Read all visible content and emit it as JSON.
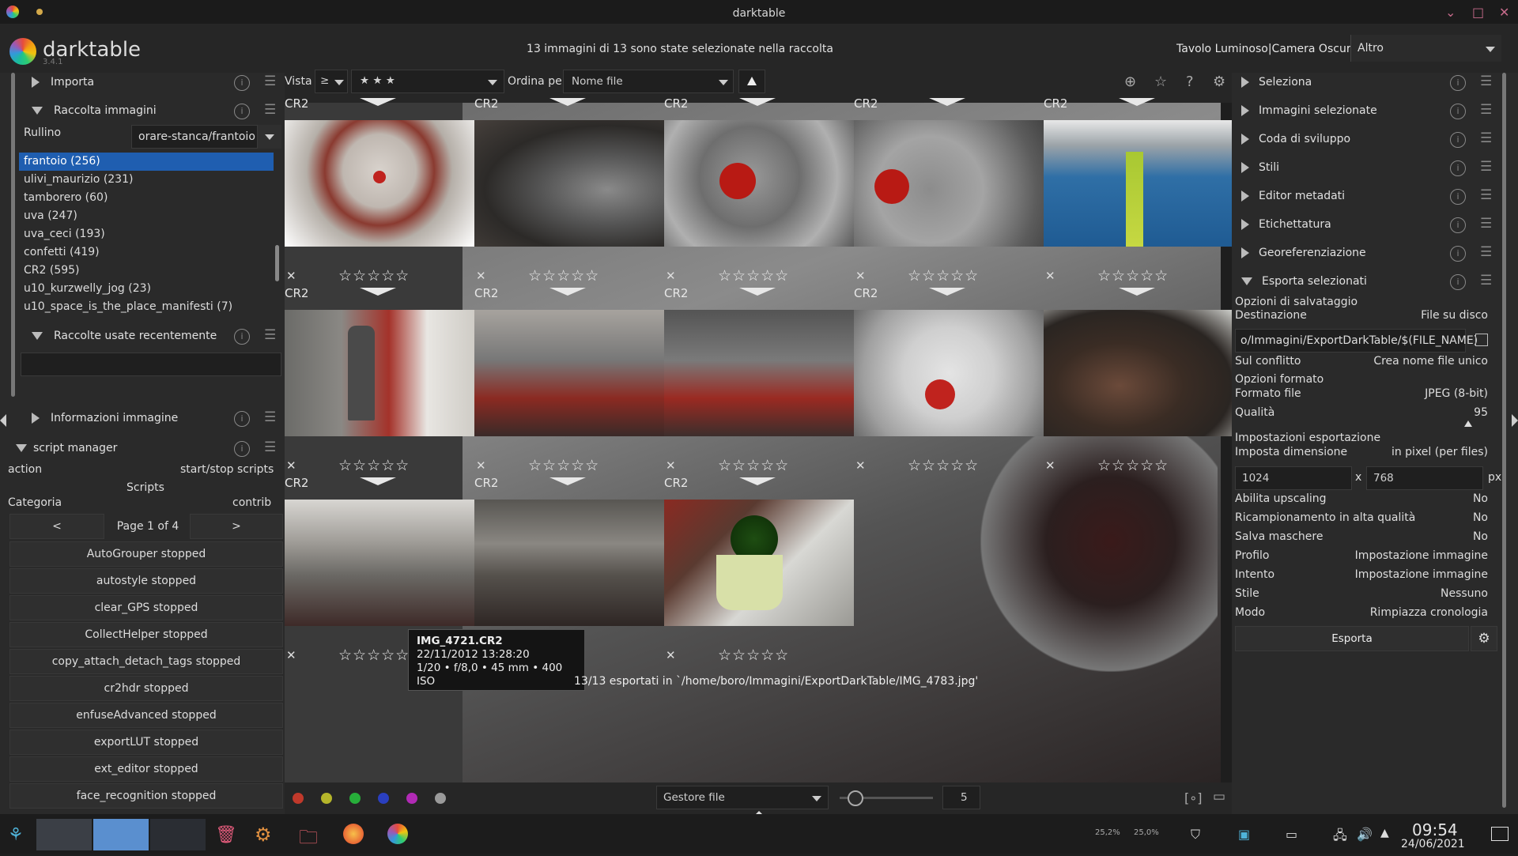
{
  "window": {
    "title": "darktable"
  },
  "header": {
    "app_name": "darktable",
    "version": "3.4.1",
    "selection_message": "13 immagini di 13 sono state selezionate nella raccolta",
    "views": "Tavolo Luminoso|Camera Oscura|",
    "views_dropdown": "Altro"
  },
  "left_panel": {
    "modules": {
      "import": "Importa",
      "collections": "Raccolta immagini",
      "recent": "Raccolte usate recentemente",
      "image_info": "Informazioni immagine",
      "script_manager": "script manager"
    },
    "collection": {
      "property": "Rullino",
      "path": "orare-stanca/frantoio",
      "items": [
        "frantoio (256)",
        "ulivi_maurizio (231)",
        "tamborero (60)",
        "uva (247)",
        "uva_ceci (193)",
        "confetti (419)",
        "CR2 (595)",
        "u10_kurzwelly_jog (23)",
        "u10_space_is_the_place_manifesti (7)"
      ]
    },
    "script_manager": {
      "action_label": "action",
      "action_value": "start/stop scripts",
      "scripts_label": "Scripts",
      "category_label": "Categoria",
      "category_value": "contrib",
      "prev": "<",
      "page": "Page 1 of 4",
      "next": ">",
      "scripts": [
        "AutoGrouper stopped",
        "autostyle stopped",
        "clear_GPS stopped",
        "CollectHelper stopped",
        "copy_attach_detach_tags stopped",
        "cr2hdr stopped",
        "enfuseAdvanced stopped",
        "exportLUT stopped",
        "ext_editor stopped",
        "face_recognition stopped"
      ]
    }
  },
  "topbar": {
    "view_label": "Vista",
    "comparator": "≥",
    "rating": "★ ★ ★",
    "sort_label": "Ordina per",
    "sort_value": "Nome file"
  },
  "grid": {
    "ext_label": "CR2",
    "reject": "✕",
    "stars": "☆☆☆☆☆"
  },
  "tooltip": {
    "filename": "IMG_4721.CR2",
    "datetime": "22/11/2012 13:28:20",
    "exif": "1/20 • f/8,0 • 45 mm • 400 ISO"
  },
  "export_message": "13/13 esportati in `/home/boro/Immagini/ExportDarkTable/IMG_4783.jpg'",
  "right_panel": {
    "modules": [
      "Seleziona",
      "Immagini selezionate",
      "Coda di sviluppo",
      "Stili",
      "Editor metadati",
      "Etichettatura",
      "Georeferenziazione",
      "Esporta selezionati"
    ],
    "export": {
      "storage_options": "Opzioni di salvataggio",
      "destination_label": "Destinazione",
      "destination_value": "File su disco",
      "path": "o/Immagini/ExportDarkTable/$(FILE_NAME)",
      "conflict_label": "Sul conflitto",
      "conflict_value": "Crea nome file unico",
      "format_options": "Opzioni formato",
      "file_format_label": "Formato file",
      "file_format_value": "JPEG (8-bit)",
      "quality_label": "Qualità",
      "quality_value": "95",
      "export_settings": "Impostazioni esportazione",
      "set_size_label": "Imposta dimensione",
      "set_size_value": "in pixel (per files)",
      "width": "1024",
      "x": "x",
      "height": "768",
      "px": "px",
      "rows": [
        {
          "label": "Abilita upscaling",
          "value": "No"
        },
        {
          "label": "Ricampionamento in alta qualità",
          "value": "No"
        },
        {
          "label": "Salva maschere",
          "value": "No"
        },
        {
          "label": "Profilo",
          "value": "Impostazione immagine"
        },
        {
          "label": "Intento",
          "value": "Impostazione immagine"
        },
        {
          "label": "Stile",
          "value": "Nessuno"
        },
        {
          "label": "Modo",
          "value": "Rimpiazza cronologia"
        }
      ],
      "export_button": "Esporta"
    }
  },
  "bottombar": {
    "layout_dropdown": "Gestore file",
    "zoom_value": "5",
    "color_labels": [
      "#c0392b",
      "#b5b52a",
      "#27ae3a",
      "#2a3fbf",
      "#b12ab5",
      "#9a9a9a"
    ]
  },
  "taskbar": {
    "cpu1": "25,2%",
    "cpu2": "25,0%",
    "time": "09:54",
    "date": "24/06/2021"
  }
}
